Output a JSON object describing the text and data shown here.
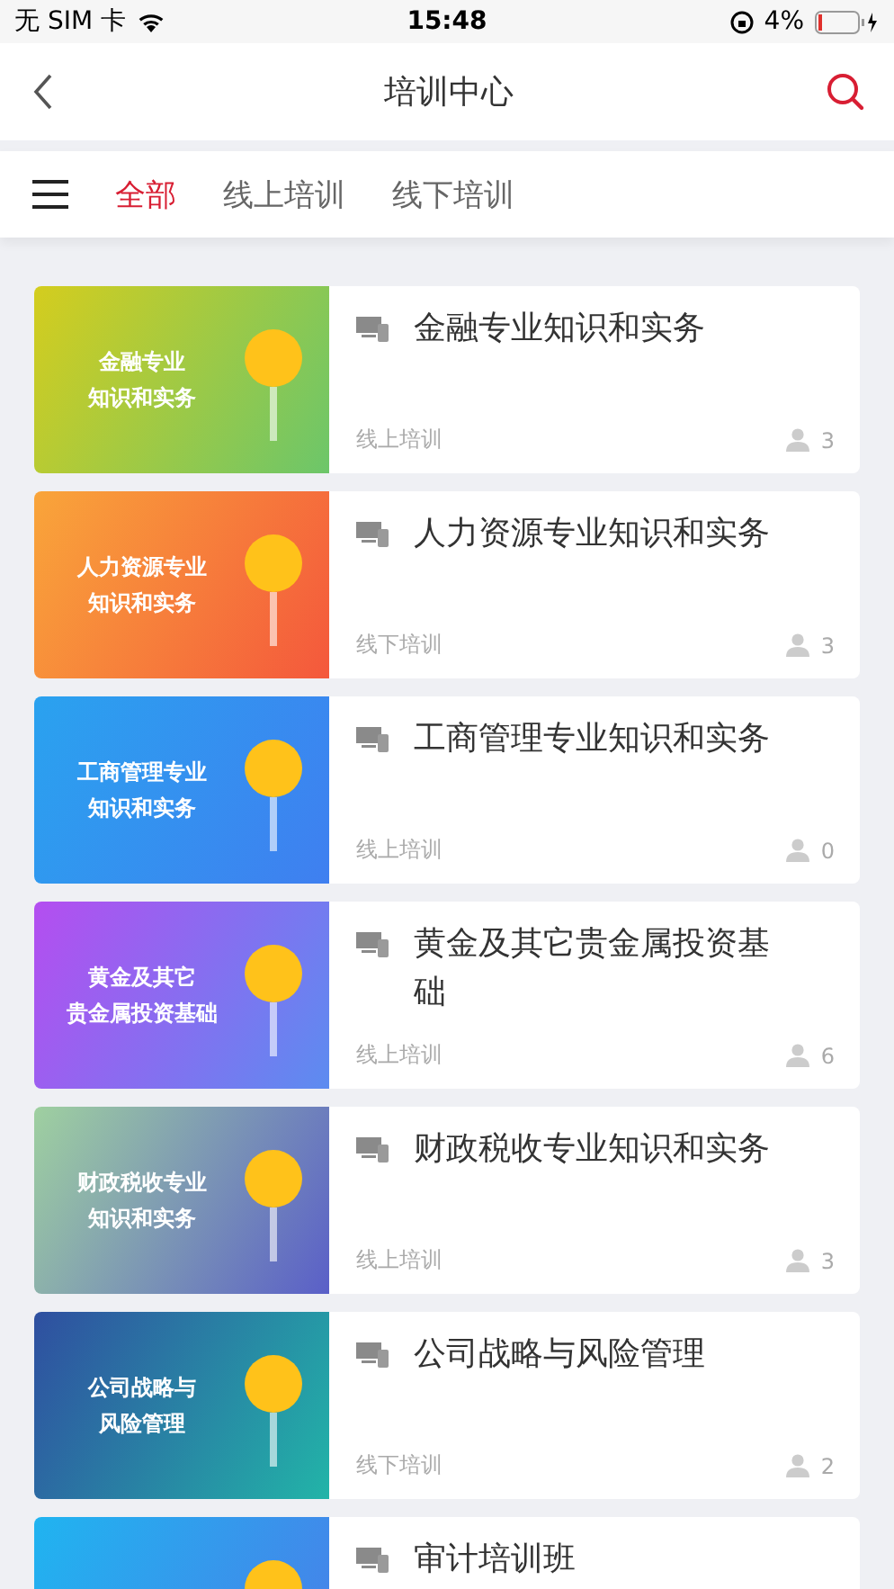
{
  "status_bar": {
    "carrier": "无 SIM 卡",
    "time": "15:48",
    "battery": "4%"
  },
  "nav": {
    "title": "培训中心"
  },
  "tabs": [
    {
      "label": "全部",
      "selected": true
    },
    {
      "label": "线上培训",
      "selected": false
    },
    {
      "label": "线下培训",
      "selected": false
    }
  ],
  "courses": [
    {
      "banner": [
        "金融专业",
        "知识和实务"
      ],
      "title": "金融专业知识和实务",
      "type": "线上培训",
      "count": "3"
    },
    {
      "banner": [
        "人力资源专业",
        "知识和实务"
      ],
      "title": "人力资源专业知识和实务",
      "type": "线下培训",
      "count": "3"
    },
    {
      "banner": [
        "工商管理专业",
        "知识和实务"
      ],
      "title": "工商管理专业知识和实务",
      "type": "线上培训",
      "count": "0"
    },
    {
      "banner": [
        "黄金及其它",
        "贵金属投资基础"
      ],
      "title": "黄金及其它贵金属投资基础",
      "type": "线上培训",
      "count": "6"
    },
    {
      "banner": [
        "财政税收专业",
        "知识和实务"
      ],
      "title": "财政税收专业知识和实务",
      "type": "线上培训",
      "count": "3"
    },
    {
      "banner": [
        "公司战略与",
        "风险管理"
      ],
      "title": "公司战略与风险管理",
      "type": "线下培训",
      "count": "2"
    },
    {
      "title": "审计培训班"
    }
  ]
}
